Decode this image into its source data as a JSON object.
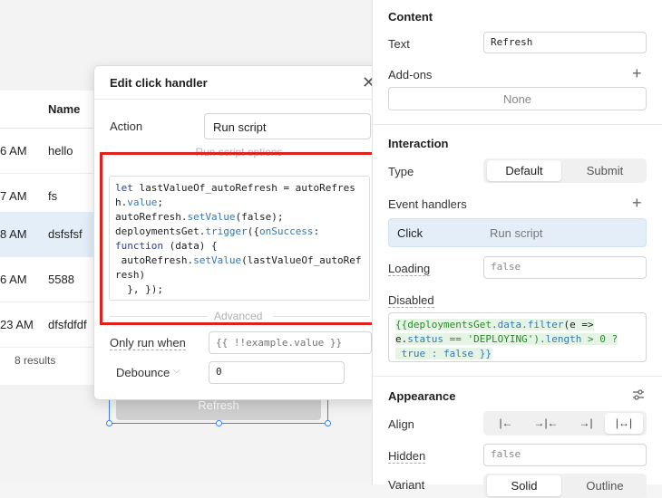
{
  "table": {
    "header_name": "Name",
    "rows": [
      {
        "time": "6 AM",
        "name": "hello"
      },
      {
        "time": "7 AM",
        "name": "fs"
      },
      {
        "time": "8 AM",
        "name": "dsfsfsf"
      },
      {
        "time": "6 AM",
        "name": "5588"
      },
      {
        "time": "23 AM",
        "name": "dfsfdfdf"
      }
    ],
    "results": "8 results"
  },
  "canvas_button": {
    "label": "Refresh"
  },
  "popup": {
    "title": "Edit click handler",
    "action_label": "Action",
    "action_value": "Run script",
    "section_label": "Run script options",
    "code": {
      "l1_kw": "let",
      "l1_rest": " lastValueOf_autoRefresh = autoRefresh.",
      "l1_prop": "value",
      "l1_end": ";",
      "l2_a": "autoRefresh.",
      "l2_prop": "setValue",
      "l2_end": "(false);",
      "l3_a": "deploymentsGet.",
      "l3_prop": "trigger",
      "l3_mid": "({",
      "l3_key": "onSuccess",
      "l3_end": ":",
      "l4_kw": "function",
      "l4_rest": " (data) {",
      "l5_a": " autoRefresh.",
      "l5_prop": "setValue",
      "l5_end": "(lastValueOf_autoRefresh)",
      "l6": "  }, });"
    },
    "advanced_label": "Advanced",
    "only_run_label": "Only run when",
    "only_run_placeholder": "{{ !!example.value }}",
    "debounce_label": "Debounce",
    "debounce_value": "0"
  },
  "panel": {
    "content_title": "Content",
    "text_label": "Text",
    "text_value": "Refresh",
    "addons_label": "Add-ons",
    "addons_value": "None",
    "interaction_title": "Interaction",
    "type_label": "Type",
    "type_options": [
      "Default",
      "Submit"
    ],
    "event_handlers_label": "Event handlers",
    "event_name": "Click",
    "event_action": "Run script",
    "loading_label": "Loading",
    "loading_value": "false",
    "disabled_label": "Disabled",
    "disabled_code": {
      "p1": "{{deploymentsGet.",
      "p2": "data",
      "p3": ".",
      "p4": "filter",
      "p5": "(e =>",
      "p6": "e.",
      "p7": "status",
      "p8": " == 'DEPLOYING').",
      "p9": "length",
      "p10": " > 0 ?",
      "p11": " true : false }}"
    },
    "appearance_title": "Appearance",
    "align_label": "Align",
    "hidden_label": "Hidden",
    "hidden_value": "false",
    "variant_label": "Variant",
    "variant_options": [
      "Solid",
      "Outline"
    ]
  },
  "icons": {
    "close": "close-icon",
    "plus": "plus-icon",
    "chevron": "chevron-down-icon",
    "settings": "sliders-icon",
    "align": [
      "align-left-icon",
      "align-center-icon",
      "align-right-icon",
      "align-stretch-icon"
    ]
  },
  "colors": {
    "highlight_box": "#e0201b",
    "selection": "#3b82f6",
    "selected_row": "#e3eef9"
  }
}
